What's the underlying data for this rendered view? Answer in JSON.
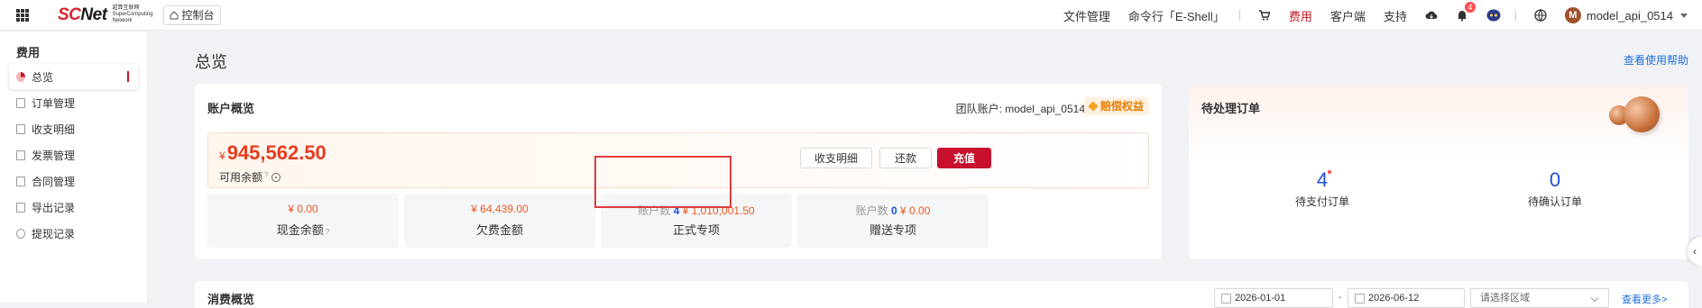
{
  "topbar": {
    "logo_main_a": "SC",
    "logo_main_b": "Net",
    "logo_sub": "超算互联网 SuperComputing Network",
    "console_label": "控制台",
    "nav": [
      "文件管理",
      "命令行「E-Shell」",
      "费用",
      "客户端",
      "支持"
    ],
    "active_nav": "费用",
    "notification_count": "4",
    "username": "model_api_0514",
    "avatar_letter": "M"
  },
  "sidebar": {
    "title": "费用",
    "items": [
      {
        "label": "总览",
        "active": true
      },
      {
        "label": "订单管理"
      },
      {
        "label": "收支明细"
      },
      {
        "label": "发票管理"
      },
      {
        "label": "合同管理"
      },
      {
        "label": "导出记录"
      },
      {
        "label": "提现记录"
      }
    ]
  },
  "page": {
    "title": "总览",
    "help_link": "查看使用帮助"
  },
  "account": {
    "title": "账户概览",
    "team_label": "团队账户: model_api_0514",
    "tag": "赔偿权益",
    "currency": "¥",
    "balance": "945,562.50",
    "balance_label": "可用余额",
    "qmark": "?",
    "buttons": {
      "detail": "收支明细",
      "repay": "还款",
      "recharge": "充值"
    },
    "stats": [
      {
        "value": "¥ 0.00",
        "label": "现金余额"
      },
      {
        "value": "¥ 64,439.00",
        "label": "欠费金额"
      },
      {
        "prefix": "账户数",
        "count": "4",
        "value": "¥ 1,010,001.50",
        "label": "正式专项"
      },
      {
        "prefix": "账户数",
        "count": "0",
        "value": "¥ 0.00",
        "label": "赠送专项"
      }
    ]
  },
  "orders": {
    "title": "待处理订单",
    "pending_pay": {
      "count": "4",
      "label": "待支付订单"
    },
    "pending_confirm": {
      "count": "0",
      "label": "待确认订单"
    }
  },
  "consume": {
    "title": "消费概览",
    "date_start": "2026-01-01",
    "date_sep": "-",
    "date_end": "2026-06-12",
    "region_placeholder": "请选择区域",
    "more_link": "查看更多>"
  },
  "colors": {
    "brand_red": "#c81623",
    "amount_orange": "#e63c1e",
    "link_blue": "#1f6fd9"
  }
}
